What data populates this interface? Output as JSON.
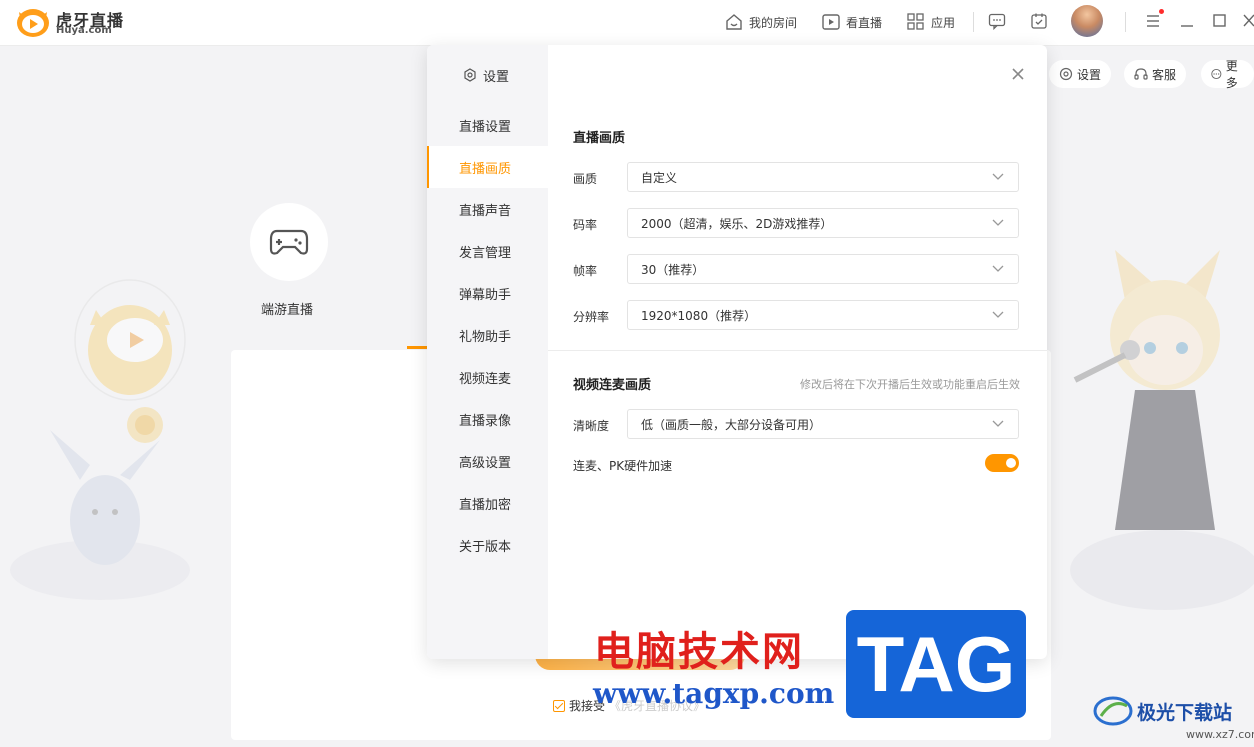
{
  "app": {
    "name": "虎牙直播",
    "domain": "Huya.com"
  },
  "topnav": {
    "my_room": "我的房间",
    "watch_live": "看直播",
    "apps": "应用"
  },
  "background": {
    "game_label": "端游直播",
    "pill_settings": "设置",
    "pill_service": "客服",
    "pill_more": "更多",
    "agree_text": "我接受",
    "agree_faded": "《虎牙直播协议》"
  },
  "settings": {
    "header": "设置",
    "menu": [
      {
        "label": "直播设置"
      },
      {
        "label": "直播画质"
      },
      {
        "label": "直播声音"
      },
      {
        "label": "发言管理"
      },
      {
        "label": "弹幕助手"
      },
      {
        "label": "礼物助手"
      },
      {
        "label": "视频连麦"
      },
      {
        "label": "直播录像"
      },
      {
        "label": "高级设置"
      },
      {
        "label": "直播加密"
      },
      {
        "label": "关于版本"
      }
    ],
    "active_item": "直播画质",
    "quality_section": {
      "title": "直播画质",
      "rows": [
        {
          "label": "画质",
          "value": "自定义"
        },
        {
          "label": "码率",
          "value": "2000（超清，娱乐、2D游戏推荐）"
        },
        {
          "label": "帧率",
          "value": "30（推荐）"
        },
        {
          "label": "分辨率",
          "value": "1920*1080（推荐）"
        }
      ]
    },
    "link_section": {
      "title": "视频连麦画质",
      "hint": "修改后将在下次开播后生效或功能重启后生效",
      "clarity_label": "清晰度",
      "clarity_value": "低（画质一般，大部分设备可用）",
      "hw_accel_label": "连麦、PK硬件加速",
      "hw_accel_on": true
    }
  },
  "watermarks": {
    "cn": "电脑技术网",
    "url": "www.tagxp.com",
    "tag": "TAG",
    "jg": "极光下载站",
    "jg_url": "www.xz7.com"
  },
  "colors": {
    "accent": "#ff9600",
    "dialog_bg": "#ffffff",
    "sidebar_bg": "#f5f5f7"
  }
}
